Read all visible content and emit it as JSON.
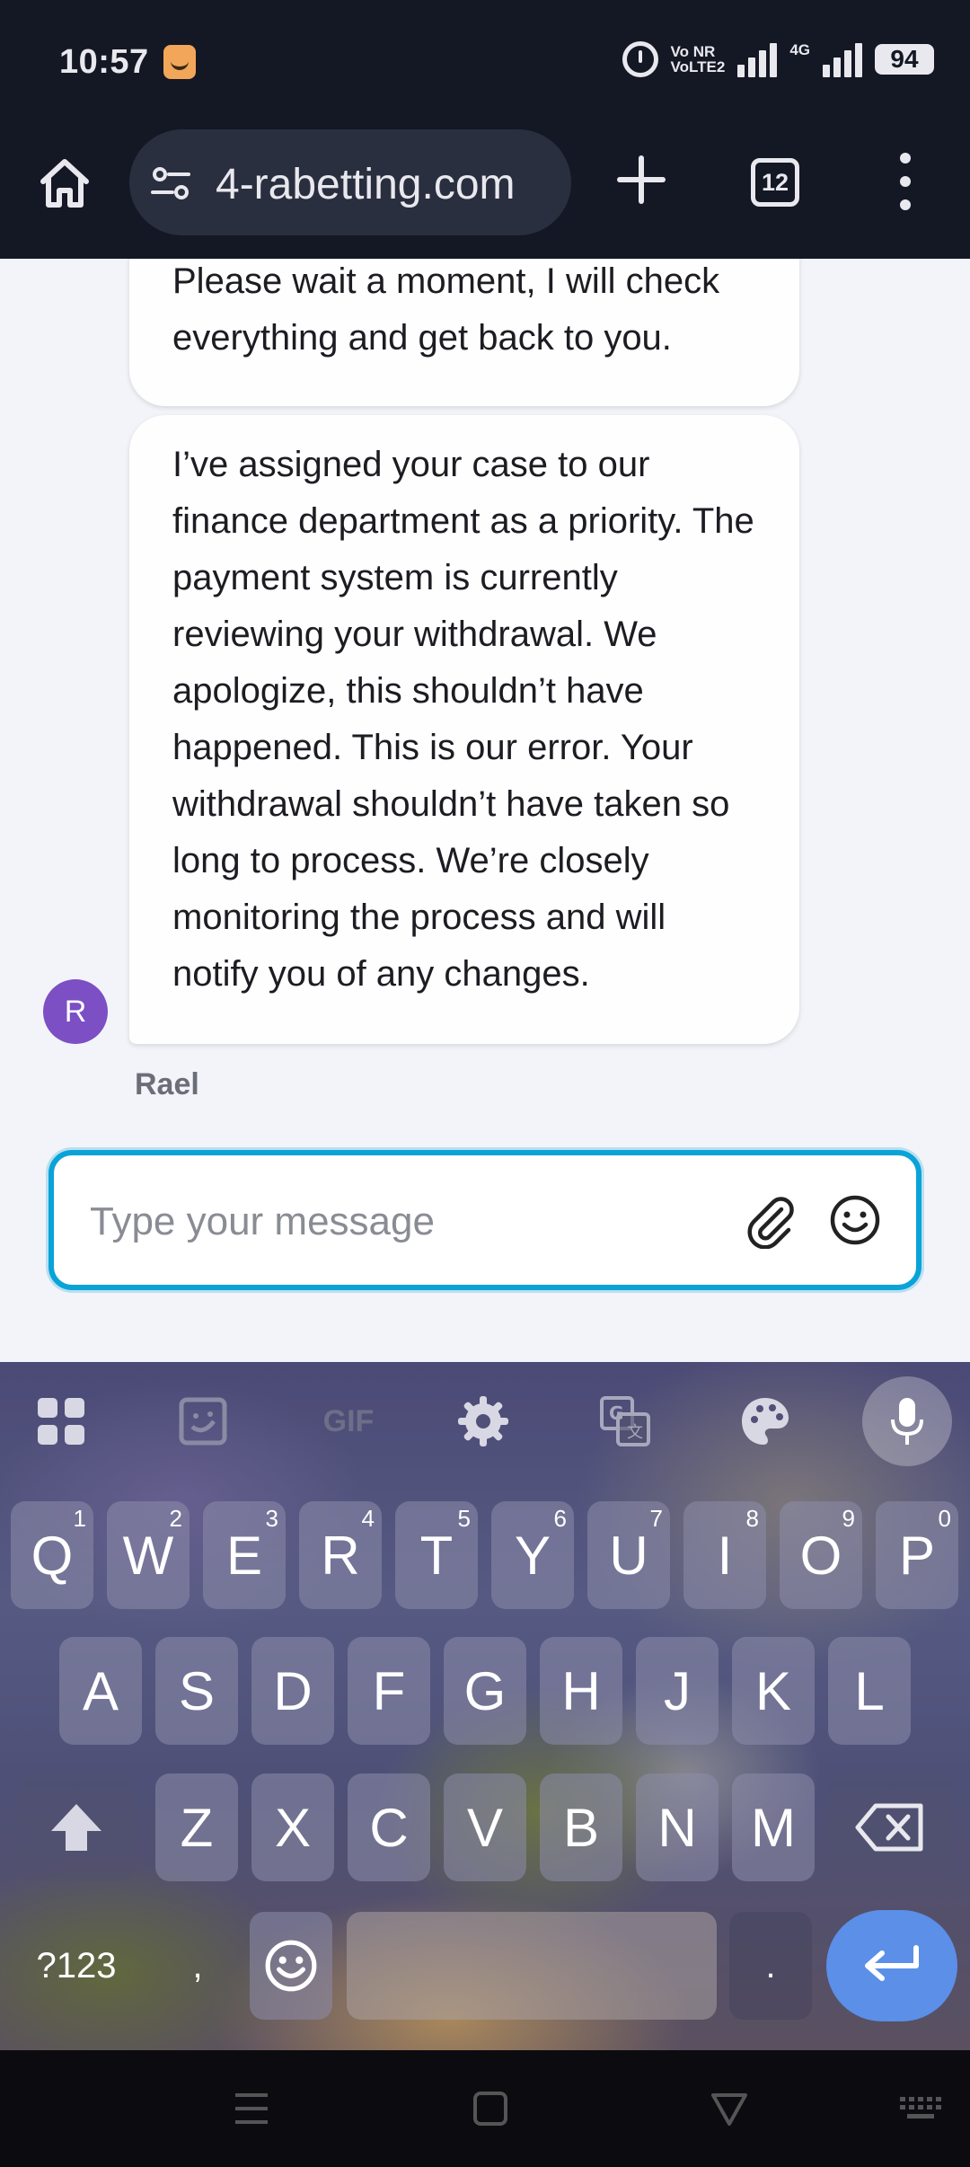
{
  "status_bar": {
    "time": "10:57",
    "volte_line1": "Vo NR",
    "volte_line2": "VoLTE2",
    "network": "4G",
    "battery": "94",
    "icons": [
      "amazon-app-icon",
      "alarm-icon",
      "signal-icon",
      "signal-4g-icon",
      "battery-icon"
    ]
  },
  "browser": {
    "url": "4-rabetting.com",
    "tab_count": "12",
    "icons": [
      "home-icon",
      "tune-icon",
      "plus-icon",
      "tabs-icon",
      "overflow-menu-icon"
    ]
  },
  "chat": {
    "messages": [
      {
        "text": "Please wait a moment, I will check everything and get back to you."
      },
      {
        "text": "I’ve assigned your case to our finance department as a priority. The payment system is currently reviewing your withdrawal. We apologize, this shouldn’t have happened. This is our error. Your withdrawal shouldn’t have taken so long to process. We’re closely monitoring the process and will notify you of any changes."
      }
    ],
    "avatar_initial": "R",
    "sender_name": "Rael",
    "composer": {
      "placeholder": "Type your message",
      "value": ""
    },
    "accent_color": "#0aa3d8",
    "avatar_color": "#7c4fc4"
  },
  "keyboard": {
    "toolbar_icons": [
      "apps-grid-icon",
      "sticker-icon",
      "gif-icon",
      "settings-icon",
      "translate-icon",
      "palette-icon",
      "microphone-icon"
    ],
    "gif_label": "GIF",
    "row1": [
      {
        "key": "Q",
        "hint": "1"
      },
      {
        "key": "W",
        "hint": "2"
      },
      {
        "key": "E",
        "hint": "3"
      },
      {
        "key": "R",
        "hint": "4"
      },
      {
        "key": "T",
        "hint": "5"
      },
      {
        "key": "Y",
        "hint": "6"
      },
      {
        "key": "U",
        "hint": "7"
      },
      {
        "key": "I",
        "hint": "8"
      },
      {
        "key": "O",
        "hint": "9"
      },
      {
        "key": "P",
        "hint": "0"
      }
    ],
    "row2": [
      "A",
      "S",
      "D",
      "F",
      "G",
      "H",
      "J",
      "K",
      "L"
    ],
    "row3": [
      "Z",
      "X",
      "C",
      "V",
      "B",
      "N",
      "M"
    ],
    "symbols_label": "?123",
    "comma_label": ",",
    "period_label": ".",
    "enter_color": "#5b8fe8"
  },
  "nav_bar": {
    "icons": [
      "recents-icon",
      "home-square-icon",
      "back-icon",
      "keyboard-toggle-icon"
    ]
  }
}
